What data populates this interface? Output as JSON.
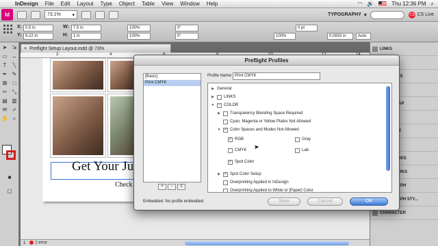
{
  "menubar": {
    "app": "InDesign",
    "items": [
      "File",
      "Edit",
      "Layout",
      "Type",
      "Object",
      "Table",
      "View",
      "Window",
      "Help"
    ],
    "clock": "Thu 12:36 PM"
  },
  "appbar": {
    "logo": "Id",
    "zoom": "73.1%",
    "workspace": "TYPOGRAPHY",
    "cslive": "CS Live"
  },
  "control": {
    "x": "0.5 in",
    "y": "9.22 in",
    "w": "7.5 in",
    "h": "1 in",
    "scale_x": "100%",
    "scale_y": "100%",
    "rotate": "0°",
    "shear": "0°",
    "stroke": "0 pt",
    "opacity": "100%",
    "offset": "0.0833 in",
    "auto": "Auto"
  },
  "document": {
    "tab": "Preflight Setup Layout.indd @ 73%",
    "ruler": [
      "2",
      "4",
      "6",
      "8",
      "10",
      "12",
      "14"
    ],
    "headline": "Get Your Ju",
    "subline": "Check"
  },
  "status": {
    "page": "1",
    "errors": "1 error"
  },
  "panels": [
    "LINKS",
    "LAYERS",
    "SWATCHES",
    "GRAPHS",
    "TEXT WRAP",
    "STROKE",
    "GRADIENT",
    "HISTORY",
    "HYPERLINKS",
    "BOOKMARKS",
    "PARAGRAPH",
    "PARAGRAPH STY...",
    "CHARACTER"
  ],
  "dialog": {
    "title": "Preflight Profiles",
    "profiles": [
      "[Basic]",
      "Print CMYK"
    ],
    "profile_name_label": "Profile Name:",
    "profile_name": "Print CMYK",
    "embedded": "Embedded:  No profile embedded.",
    "tree": [
      {
        "label": "General",
        "indent": 0,
        "tri": "▶",
        "cb": null
      },
      {
        "label": "LINKS",
        "indent": 0,
        "tri": "▶",
        "cb": "empty"
      },
      {
        "label": "COLOR",
        "indent": 0,
        "tri": "▼",
        "cb": "dash"
      },
      {
        "label": "Transparency Blending Space Required",
        "indent": 1,
        "tri": "▶",
        "cb": "empty"
      },
      {
        "label": "Cyan, Magenta or Yellow Plates Not Allowed",
        "indent": 1,
        "tri": "",
        "cb": "empty"
      },
      {
        "label": "Color Spaces and Modes Not Allowed",
        "indent": 1,
        "tri": "▼",
        "cb": "checked"
      },
      {
        "label": "RGB",
        "indent": 2,
        "tri": "",
        "cb": "checked"
      },
      {
        "label": "CMYK",
        "indent": 2,
        "tri": "",
        "cb": "empty"
      },
      {
        "label": "Spot Color",
        "indent": 2,
        "tri": "",
        "cb": "checked"
      },
      {
        "label": "Spot Color Setup",
        "indent": 1,
        "tri": "▶",
        "cb": "checked"
      },
      {
        "label": "Overprinting Applied in InDesign",
        "indent": 1,
        "tri": "",
        "cb": "empty"
      },
      {
        "label": "Overprinting Applied to White or [Paper] Color",
        "indent": 1,
        "tri": "",
        "cb": "empty"
      }
    ],
    "side_options": [
      {
        "label": "Gray",
        "cb": "empty"
      },
      {
        "label": "Lab",
        "cb": "empty"
      }
    ],
    "buttons": {
      "save": "Save",
      "cancel": "Cancel",
      "ok": "OK"
    }
  },
  "colors": {
    "accent": "#3d7ad6",
    "selection": "#b8cff0",
    "brand": "#d9007a"
  }
}
